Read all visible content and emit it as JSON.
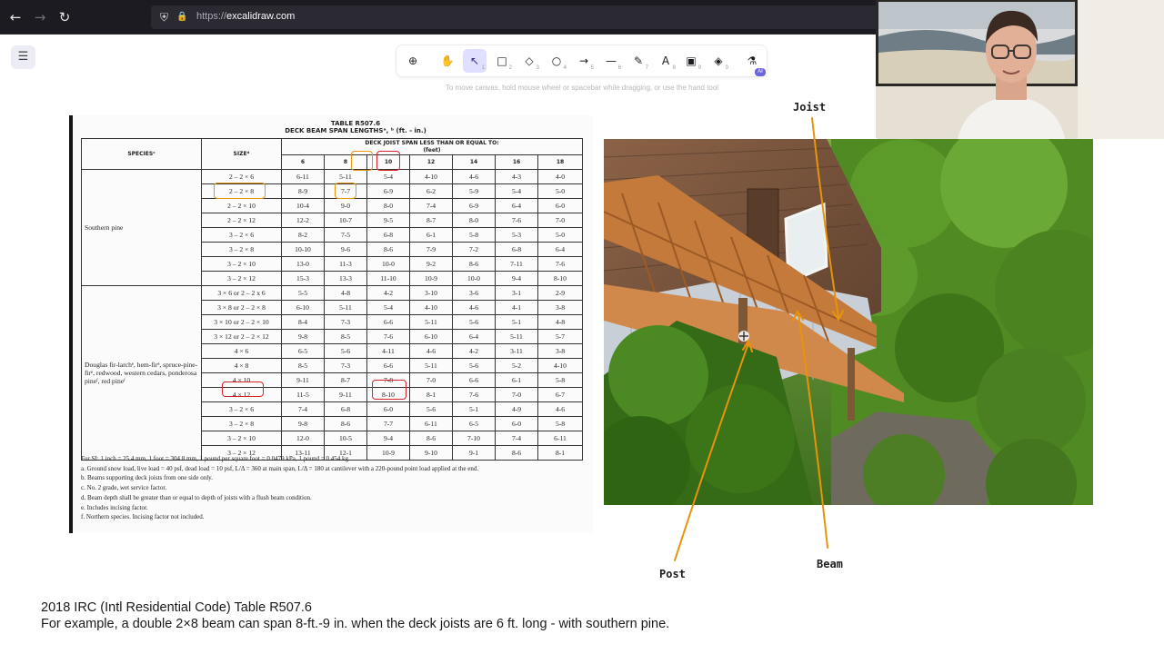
{
  "browser": {
    "url_scheme": "https://",
    "url_host": "excalidraw.com",
    "back_icon": "←",
    "forward_icon": "→",
    "reload_icon": "↻",
    "shield_icon": "⛨",
    "lock_icon": "🔒"
  },
  "excalidraw": {
    "menu_icon": "☰",
    "tools": [
      {
        "name": "lock",
        "glyph": "⊕",
        "key": ""
      },
      {
        "name": "hand",
        "glyph": "✋",
        "key": ""
      },
      {
        "name": "selection",
        "glyph": "↖",
        "key": "1"
      },
      {
        "name": "rectangle",
        "glyph": "□",
        "key": "2"
      },
      {
        "name": "diamond",
        "glyph": "◇",
        "key": "3"
      },
      {
        "name": "ellipse",
        "glyph": "○",
        "key": "4"
      },
      {
        "name": "arrow",
        "glyph": "→",
        "key": "5"
      },
      {
        "name": "line",
        "glyph": "—",
        "key": "6"
      },
      {
        "name": "draw",
        "glyph": "✎",
        "key": "7"
      },
      {
        "name": "text",
        "glyph": "A",
        "key": "8"
      },
      {
        "name": "image",
        "glyph": "▣",
        "key": "9"
      },
      {
        "name": "eraser",
        "glyph": "◈",
        "key": "0"
      },
      {
        "name": "ai",
        "glyph": "⚗",
        "key": "",
        "badge": "AI"
      }
    ],
    "hint": "To move canvas, hold mouse wheel or spacebar while dragging, or use the hand tool"
  },
  "span_table": {
    "title_line1": "TABLE R507.6",
    "title_line2": "DECK BEAM SPAN LENGTHSᵃ, ᵇ (ft. - in.)",
    "head_species": "SPECIESᶜ",
    "head_size": "SIZEᵈ",
    "head_span": "DECK JOIST SPAN LESS THAN OR EQUAL TO:",
    "head_span_unit": "(feet)",
    "span_columns": [
      "6",
      "8",
      "10",
      "12",
      "14",
      "16",
      "18"
    ],
    "groups": [
      {
        "species": "Southern pine",
        "rows": [
          {
            "size": "2 – 2 × 6",
            "values": [
              "6-11",
              "5-11",
              "5-4",
              "4-10",
              "4-6",
              "4-3",
              "4-0"
            ]
          },
          {
            "size": "2 – 2 × 8",
            "values": [
              "8-9",
              "7-7",
              "6-9",
              "6-2",
              "5-9",
              "5-4",
              "5-0"
            ]
          },
          {
            "size": "2 – 2 × 10",
            "values": [
              "10-4",
              "9-0",
              "8-0",
              "7-4",
              "6-9",
              "6-4",
              "6-0"
            ]
          },
          {
            "size": "2 – 2 × 12",
            "values": [
              "12-2",
              "10-7",
              "9-5",
              "8-7",
              "8-0",
              "7-6",
              "7-0"
            ]
          },
          {
            "size": "3 – 2 × 6",
            "values": [
              "8-2",
              "7-5",
              "6-8",
              "6-1",
              "5-8",
              "5-3",
              "5-0"
            ]
          },
          {
            "size": "3 – 2 × 8",
            "values": [
              "10-10",
              "9-6",
              "8-6",
              "7-9",
              "7-2",
              "6-8",
              "6-4"
            ]
          },
          {
            "size": "3 – 2 × 10",
            "values": [
              "13-0",
              "11-3",
              "10-0",
              "9-2",
              "8-6",
              "7-11",
              "7-6"
            ]
          },
          {
            "size": "3 – 2 × 12",
            "values": [
              "15-3",
              "13-3",
              "11-10",
              "10-9",
              "10-0",
              "9-4",
              "8-10"
            ]
          }
        ]
      },
      {
        "species": "Douglas fir-larchᵉ, hem-firᵉ, spruce-pine-firᵉ, redwood, western cedars, ponderosa pineᶠ, red pineᶠ",
        "rows": [
          {
            "size": "3 × 6 or 2 – 2 x 6",
            "values": [
              "5-5",
              "4-8",
              "4-2",
              "3-10",
              "3-6",
              "3-1",
              "2-9"
            ]
          },
          {
            "size": "3 × 8 or 2 – 2 × 8",
            "values": [
              "6-10",
              "5-11",
              "5-4",
              "4-10",
              "4-6",
              "4-1",
              "3-8"
            ]
          },
          {
            "size": "3 × 10 or 2 – 2 × 10",
            "values": [
              "8-4",
              "7-3",
              "6-6",
              "5-11",
              "5-6",
              "5-1",
              "4-8"
            ]
          },
          {
            "size": "3 × 12 or 2 – 2 × 12",
            "values": [
              "9-8",
              "8-5",
              "7-6",
              "6-10",
              "6-4",
              "5-11",
              "5-7"
            ]
          },
          {
            "size": "4 × 6",
            "values": [
              "6-5",
              "5-6",
              "4-11",
              "4-6",
              "4-2",
              "3-11",
              "3-8"
            ]
          },
          {
            "size": "4 × 8",
            "values": [
              "8-5",
              "7-3",
              "6-6",
              "5-11",
              "5-6",
              "5-2",
              "4-10"
            ]
          },
          {
            "size": "4 × 10",
            "values": [
              "9-11",
              "8-7",
              "7-8",
              "7-0",
              "6-6",
              "6-1",
              "5-8"
            ]
          },
          {
            "size": "4 × 12",
            "values": [
              "11-5",
              "9-11",
              "8-10",
              "8-1",
              "7-6",
              "7-0",
              "6-7"
            ]
          },
          {
            "size": "3 – 2 × 6",
            "values": [
              "7-4",
              "6-8",
              "6-0",
              "5-6",
              "5-1",
              "4-9",
              "4-6"
            ]
          },
          {
            "size": "3 – 2 × 8",
            "values": [
              "9-8",
              "8-6",
              "7-7",
              "6-11",
              "6-5",
              "6-0",
              "5-8"
            ]
          },
          {
            "size": "3 – 2 × 10",
            "values": [
              "12-0",
              "10-5",
              "9-4",
              "8-6",
              "7-10",
              "7-4",
              "6-11"
            ]
          },
          {
            "size": "3 – 2 × 12",
            "values": [
              "13-11",
              "12-1",
              "10-9",
              "9-10",
              "9-1",
              "8-6",
              "8-1"
            ]
          }
        ]
      }
    ],
    "notes": [
      "For SI: 1 inch = 25.4 mm, 1 foot = 304.8 mm, 1 pound per square foot = 0.0479 kPa, 1 pound = 0.454 kg.",
      "a. Ground snow load, live load = 40 psf, dead load = 10 psf, L/Δ = 360 at main span, L/Δ = 180 at cantilever with a 220-pound point load applied at the end.",
      "b. Beams supporting deck joists from one side only.",
      "c. No. 2 grade, wet service factor.",
      "d. Beam depth shall be greater than or equal to depth of joists with a flush beam condition.",
      "e. Includes incising factor.",
      "f. Northern species. Incising factor not included."
    ]
  },
  "labels": {
    "joist": "Joist",
    "post": "Post",
    "beam": "Beam"
  },
  "colors": {
    "orange": "#e8930c",
    "red": "#d6222b",
    "accent": "#6965db"
  },
  "caption": {
    "line1": "2018 IRC (Intl Residential Code) Table R507.6",
    "line2": "For example, a double 2×8 beam can span 8-ft.-9 in. when the deck joists are 6 ft. long - with southern pine."
  }
}
